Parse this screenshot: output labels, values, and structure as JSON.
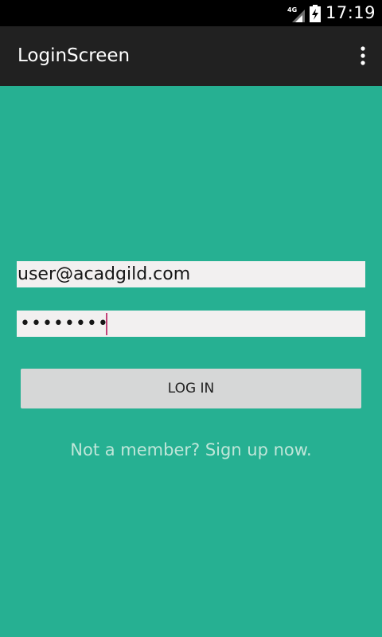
{
  "status_bar": {
    "network_label": "4G",
    "time": "17:19"
  },
  "action_bar": {
    "title": "LoginScreen",
    "overflow_icon": "more-vert-icon"
  },
  "form": {
    "email_value": "user@acadgild.com",
    "password_masked": "••••••••",
    "login_label": "LOG IN",
    "signup_link": "Not a member? Sign up now."
  },
  "colors": {
    "background": "#26b092",
    "action_bar": "#212121",
    "status_bar": "#000000",
    "field_background": "#f2f0f0",
    "button_background": "#d6d7d7",
    "link_text": "#bfe6d9",
    "cursor": "#c2447a"
  }
}
